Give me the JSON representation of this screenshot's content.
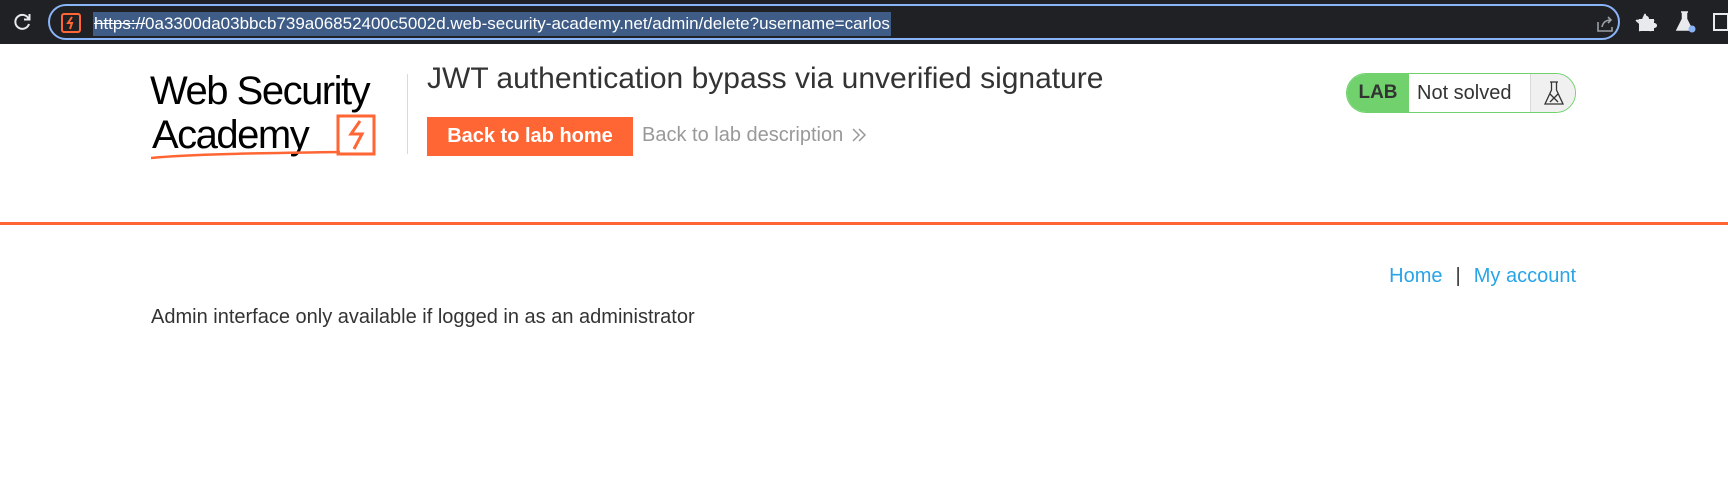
{
  "browser": {
    "url_protocol": "https://",
    "url_rest": "0a3300da03bbcb739a06852400c5002d.web-security-academy.net/admin/delete?username=carlos"
  },
  "header": {
    "logo_text": "Web Security Academy",
    "lab_title": "JWT authentication bypass via unverified signature",
    "back_home_label": "Back to lab home",
    "back_description_label": "Back to lab description"
  },
  "lab_status": {
    "badge": "LAB",
    "status": "Not solved"
  },
  "nav": {
    "home": "Home",
    "separator": "|",
    "my_account": "My account"
  },
  "main": {
    "message": "Admin interface only available if logged in as an administrator"
  },
  "colors": {
    "accent_orange": "#ff6633",
    "lab_green": "#70d16d",
    "link_blue": "#29a4e6"
  }
}
